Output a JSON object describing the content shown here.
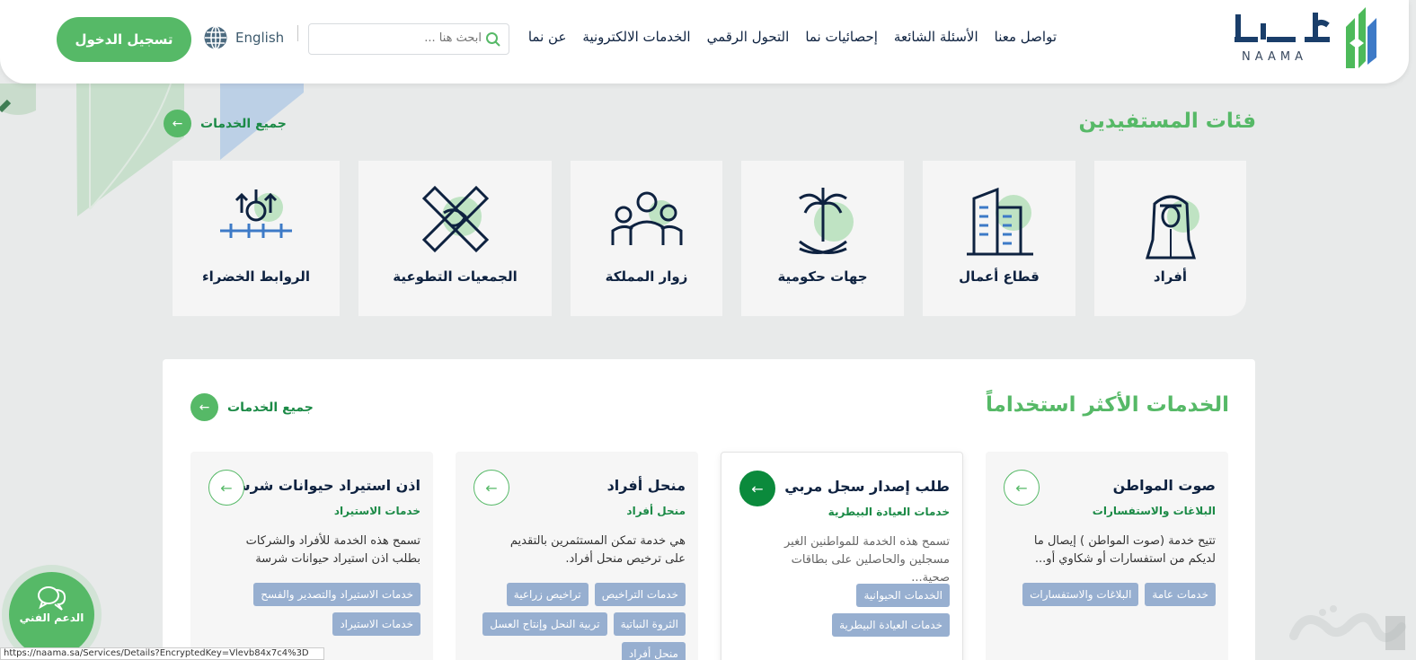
{
  "header": {
    "logo_text": "NAAMA",
    "nav": [
      "عن نما",
      "الخدمات الالكترونية",
      "التحول الرقمي",
      "إحصائيات نما",
      "الأسئلة الشائعة",
      "تواصل معنا"
    ],
    "search_placeholder": "ابحث هنا ...",
    "language": "English",
    "login": "تسجيل الدخول"
  },
  "beneficiaries": {
    "title": "فئات المستفيدين",
    "all_services": "جميع الخدمات",
    "categories": [
      "أفراد",
      "قطاع أعمال",
      "جهات حكومية",
      "زوار المملكة",
      "الجمعيات التطوعية",
      "الروابط الخضراء"
    ]
  },
  "most_used": {
    "title": "الخدمات الأكثر استخداماً",
    "all_services": "جميع الخدمات",
    "cards": [
      {
        "title": "صوت المواطن",
        "subtitle": "البلاغات والاستفسارات",
        "desc": "تتيح خدمة (صوت المواطن ) إيصال ما لديكم من استفسارات أو شكاوي أو...",
        "tags": [
          "خدمات عامة",
          "البلاغات والاستفسارات"
        ]
      },
      {
        "title": "طلب إصدار سجل مربي",
        "subtitle": "خدمات العيادة البيطرية",
        "desc": "تسمح هذه الخدمة للمواطنين الغير مسجلين والحاصلين على بطاقات صحية...",
        "tags": [
          "الخدمات الحيوانية",
          "خدمات العيادة البيطرية"
        ]
      },
      {
        "title": "منحل أفراد",
        "subtitle": "منحل أفراد",
        "desc": "هي خدمة تمكن المستثمرين بالتقديم على ترخيص منحل أفراد.",
        "tags": [
          "خدمات التراخيص",
          "تراخيص زراعية",
          "الثروة النباتية",
          "تربية النحل وإنتاج العسل",
          "منحل أفراد"
        ]
      },
      {
        "title": "اذن استيراد حيوانات شرسة",
        "subtitle": "خدمات الاستيراد",
        "desc": "تسمح هذه الخدمة للأفراد والشركات بطلب اذن استيراد حيوانات شرسة",
        "tags": [
          "خدمات الاستيراد والتصدير والفسح",
          "خدمات الاستيراد"
        ]
      }
    ]
  },
  "support": "الدعم الفني",
  "status_url": "https://naama.sa/Services/Details?EncryptedKey=Vlevb84x7c4%3D",
  "colors": {
    "green": "#56b967",
    "dark_green": "#0b8a3c",
    "navy": "#0e2240",
    "tag": "#97afd0"
  }
}
